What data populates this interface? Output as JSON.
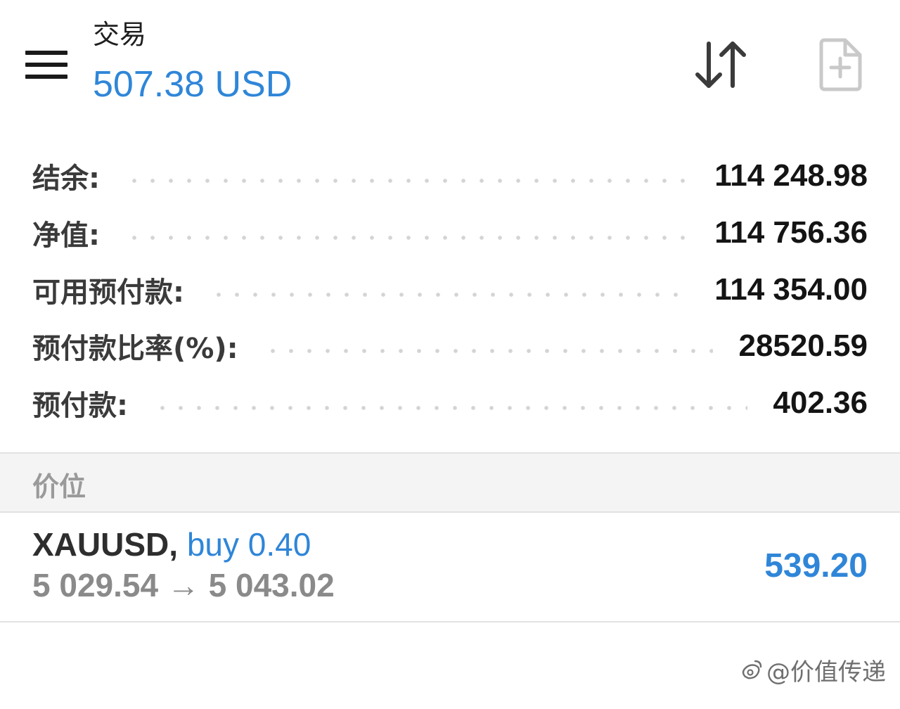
{
  "header": {
    "title": "交易",
    "profit": "507.38 USD",
    "menu_icon": "hamburger-menu-icon",
    "sort_icon": "sort-arrows-icon",
    "new_order_icon": "new-document-plus-icon"
  },
  "account": [
    {
      "label": "结余:",
      "value": "114 248.98"
    },
    {
      "label": "净值:",
      "value": "114 756.36"
    },
    {
      "label": "可用预付款:",
      "value": "114 354.00"
    },
    {
      "label": "预付款比率(%):",
      "value": "28520.59"
    },
    {
      "label": "预付款:",
      "value": "402.36"
    }
  ],
  "section": {
    "label": "价位"
  },
  "position": {
    "symbol": "XAUUSD,",
    "type": "buy 0.40",
    "prices": "5 029.54 → 5 043.02",
    "profit": "539.20"
  },
  "watermark": {
    "text": "@价值传递"
  },
  "colors": {
    "accent": "#2f86d8",
    "text_primary": "#141414",
    "text_muted": "#8a8a8a",
    "section_bg": "#f4f4f4"
  }
}
